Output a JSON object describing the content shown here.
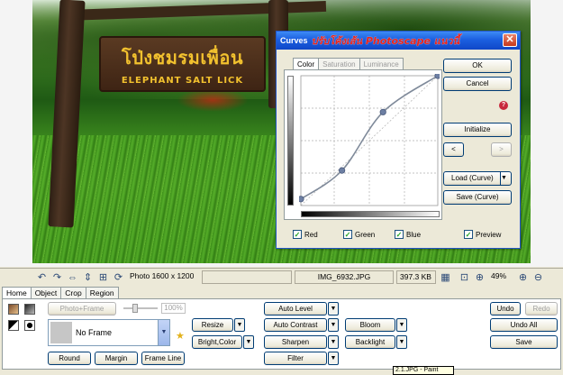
{
  "photo": {
    "sign_thai": "โป่งชมรมเพื่อน",
    "sign_english": "ELEPHANT SALT LICK"
  },
  "curves_dialog": {
    "title": "Curves",
    "overlay_text": "ปรับโค้งเส้น Photoscape แนวนี้",
    "tabs": [
      "Color",
      "Saturation",
      "Luminance"
    ],
    "active_tab": "Color",
    "buttons": {
      "ok": "OK",
      "cancel": "Cancel",
      "initialize": "Initialize",
      "prev": "<",
      "next": ">",
      "load": "Load (Curve)",
      "save": "Save (Curve)"
    },
    "help_icon": "?",
    "curve_points": [
      [
        0,
        0.05
      ],
      [
        0.3,
        0.27
      ],
      [
        0.6,
        0.72
      ],
      [
        1,
        1
      ]
    ],
    "checkboxes": [
      {
        "label": "Red",
        "checked": true
      },
      {
        "label": "Green",
        "checked": true
      },
      {
        "label": "Blue",
        "checked": true
      },
      {
        "label": "Preview",
        "checked": true
      }
    ]
  },
  "statusbar": {
    "photo_size": "Photo 1600 x 1200",
    "filename": "IMG_6932.JPG",
    "filesize": "397.3 KB",
    "zoom": "49%"
  },
  "panel": {
    "tabs": [
      "Home",
      "Object",
      "Crop",
      "Region"
    ],
    "active_tab": "Home",
    "photo_frame_button": "Photo+Frame",
    "frame_percent": "100%",
    "frame_select_value": "No Frame",
    "round_button": "Round",
    "margin_button": "Margin",
    "frame_line_button": "Frame Line",
    "resize": "Resize",
    "bright_color": "Bright,Color",
    "auto_level": "Auto Level",
    "auto_contrast": "Auto Contrast",
    "sharpen": "Sharpen",
    "filter": "Filter",
    "bloom": "Bloom",
    "backlight": "Backlight",
    "undo": "Undo",
    "redo": "Redo",
    "undo_all": "Undo All",
    "save": "Save"
  },
  "taskbar_tooltip": "2.1.JPG - Paint"
}
